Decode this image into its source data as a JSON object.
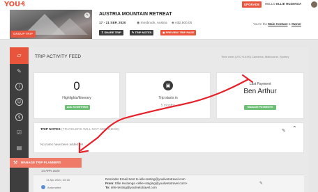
{
  "topbar": {
    "logo": "YOU₰",
    "upgrade_label": "UPGRADE",
    "hello_prefix": "HELLO",
    "user_name": "ELLIE HUZENGA"
  },
  "trip": {
    "group_badge": "GROUP TRIP",
    "title": "AUSTRIA MOUNTAIN RETREAT",
    "dates": "17 - 21 SEP, 2020",
    "location": "Innsbruck, Austria",
    "price": "A$2,500.00",
    "contact_prefix": "You're the",
    "contact_role1": "Main Contact",
    "contact_amp": "&",
    "contact_role2": "Owner",
    "buttons": {
      "share": "SHARE TRIP",
      "notes": "TRIP NOTES",
      "preview": "PREVIEW TRIP PAGE"
    }
  },
  "feed": {
    "title": "TRIP ACTIVITY FEED",
    "timezone": "Time zone (UTC+10:00) Canberra, Melbourne, Sydney"
  },
  "cards": {
    "highlights": {
      "value": "0",
      "label": "Highlights/Itinerary",
      "button": "ADD SOMETHING"
    },
    "start": {
      "label": "Trip starts in",
      "sub": "5 months"
    },
    "payment": {
      "label": "Last Payment",
      "name": "Ben Arthur",
      "button": "MANAGE PAYMENTS"
    }
  },
  "notes": {
    "title": "TRIP NOTES",
    "subtitle": "(TRAVELERS WILL NOT SEE THESE)",
    "empty": "No notes have been added yet."
  },
  "manage": {
    "label": "MANAGE TRIP PLANNERS"
  },
  "log": {
    "date": "14 APR 2020",
    "time": "14 Apr 2020, 03:18",
    "author": "Automated",
    "line1": "Reminder Email Sent to ielle-testing@youlivetotravel.com",
    "from_label": "From:",
    "from_value": "Ellie Huizenga <ellie+staging@youlivetotravel.com>",
    "to_label": "To:",
    "to_value": "ielle-testing@youlivetotravel.com"
  },
  "colors": {
    "accent": "#e8543c",
    "green": "#6cbf75",
    "sidebar": "#3e3e3e",
    "annotation": "#e8202a"
  }
}
